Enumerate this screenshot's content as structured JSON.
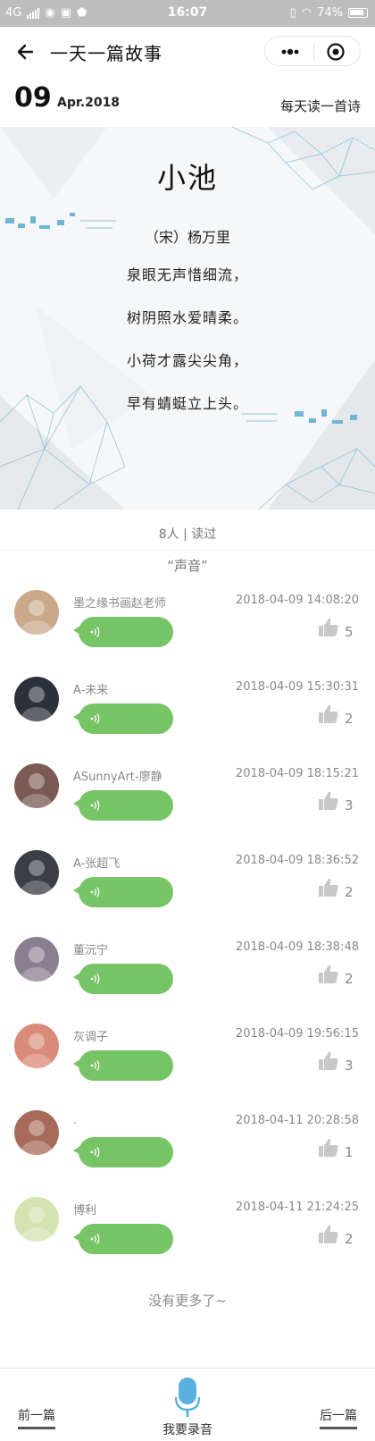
{
  "status_bar": {
    "network": "4G",
    "time": "16:07",
    "battery": "74%"
  },
  "nav": {
    "title": "一天一篇故事",
    "back_icon": "back-arrow-icon",
    "more_icon": "more-dots-icon",
    "close_icon": "close-target-icon"
  },
  "date": {
    "day": "09",
    "month_year": "Apr.2018",
    "daily_label": "每天读一首诗"
  },
  "poem": {
    "title": "小池",
    "author": "（宋）杨万里",
    "lines": [
      "泉眼无声惜细流，",
      "树阴照水爱晴柔。",
      "小荷才露尖尖角，",
      "早有蜻蜓立上头。"
    ]
  },
  "read_count": "8人 | 读过",
  "voices_title": "“声音”",
  "comments": [
    {
      "name": "墨之缘书画赵老师",
      "time": "2018-04-09 14:08:20",
      "likes": "5",
      "avatar_color": "#c9a98a"
    },
    {
      "name": "A-未来",
      "time": "2018-04-09 15:30:31",
      "likes": "2",
      "avatar_color": "#2c3038"
    },
    {
      "name": "ASunnyArt-廖静",
      "time": "2018-04-09 18:15:21",
      "likes": "3",
      "avatar_color": "#7a5a52"
    },
    {
      "name": "A-张超飞",
      "time": "2018-04-09 18:36:52",
      "likes": "2",
      "avatar_color": "#3a3d44"
    },
    {
      "name": "董沅宁",
      "time": "2018-04-09 18:38:48",
      "likes": "2",
      "avatar_color": "#8a7f90"
    },
    {
      "name": "灰调子",
      "time": "2018-04-09 19:56:15",
      "likes": "3",
      "avatar_color": "#d98a78"
    },
    {
      "name": ".",
      "time": "2018-04-11 20:28:58",
      "likes": "1",
      "avatar_color": "#a86a5a"
    },
    {
      "name": "博利",
      "time": "2018-04-11 21:24:25",
      "likes": "2",
      "avatar_color": "#d4e3b0"
    }
  ],
  "no_more": "没有更多了~",
  "bottom": {
    "prev_label": "前一篇",
    "record_label": "我要录音",
    "next_label": "后一篇"
  },
  "colors": {
    "voice_bubble": "#76c465",
    "mic": "#5ab0de",
    "status_bar": "#bdbdbd"
  }
}
